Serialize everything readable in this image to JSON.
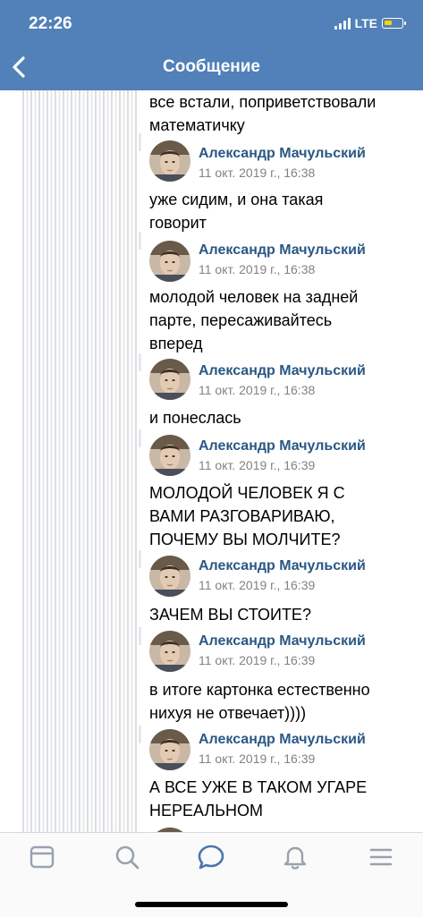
{
  "status_bar": {
    "time": "22:26",
    "network": "LTE",
    "battery_color": "#ffd200"
  },
  "header": {
    "title": "Сообщение",
    "background": "#5181b8"
  },
  "messages": [
    {
      "text": "все встали, поприветствовали\nматематичку"
    },
    {
      "author": "Александр Мачульский",
      "date": "11 окт. 2019 г., 16:38",
      "text": "уже сидим, и она такая\nговорит"
    },
    {
      "author": "Александр Мачульский",
      "date": "11 окт. 2019 г., 16:38",
      "text": "молодой человек на задней\nпарте, пересаживайтесь\nвперед"
    },
    {
      "author": "Александр Мачульский",
      "date": "11 окт. 2019 г., 16:38",
      "text": "и понеслась"
    },
    {
      "author": "Александр Мачульский",
      "date": "11 окт. 2019 г., 16:39",
      "text": "МОЛОДОЙ ЧЕЛОВЕК Я С\nВАМИ РАЗГОВАРИВАЮ,\nПОЧЕМУ ВЫ МОЛЧИТЕ?"
    },
    {
      "author": "Александр Мачульский",
      "date": "11 окт. 2019 г., 16:39",
      "text": "ЗАЧЕМ ВЫ СТОИТЕ?"
    },
    {
      "author": "Александр Мачульский",
      "date": "11 окт. 2019 г., 16:39",
      "text": "в итоге картонка естественно\nнихуя не отвечает))))"
    },
    {
      "author": "Александр Мачульский",
      "date": "11 окт. 2019 г., 16:39",
      "text": "А ВСЕ УЖЕ В ТАКОМ УГАРЕ\nНЕРЕАЛЬНОМ"
    }
  ],
  "tabbar": {
    "icons": [
      "news-icon",
      "search-icon",
      "messages-icon",
      "notifications-icon",
      "menu-icon"
    ],
    "active": "messages-icon",
    "active_color": "#4a76a8",
    "inactive_color": "#99a2ad"
  },
  "colors": {
    "author_name": "#2a5885",
    "date": "#828282",
    "quote_line": "#e7e8ec"
  }
}
